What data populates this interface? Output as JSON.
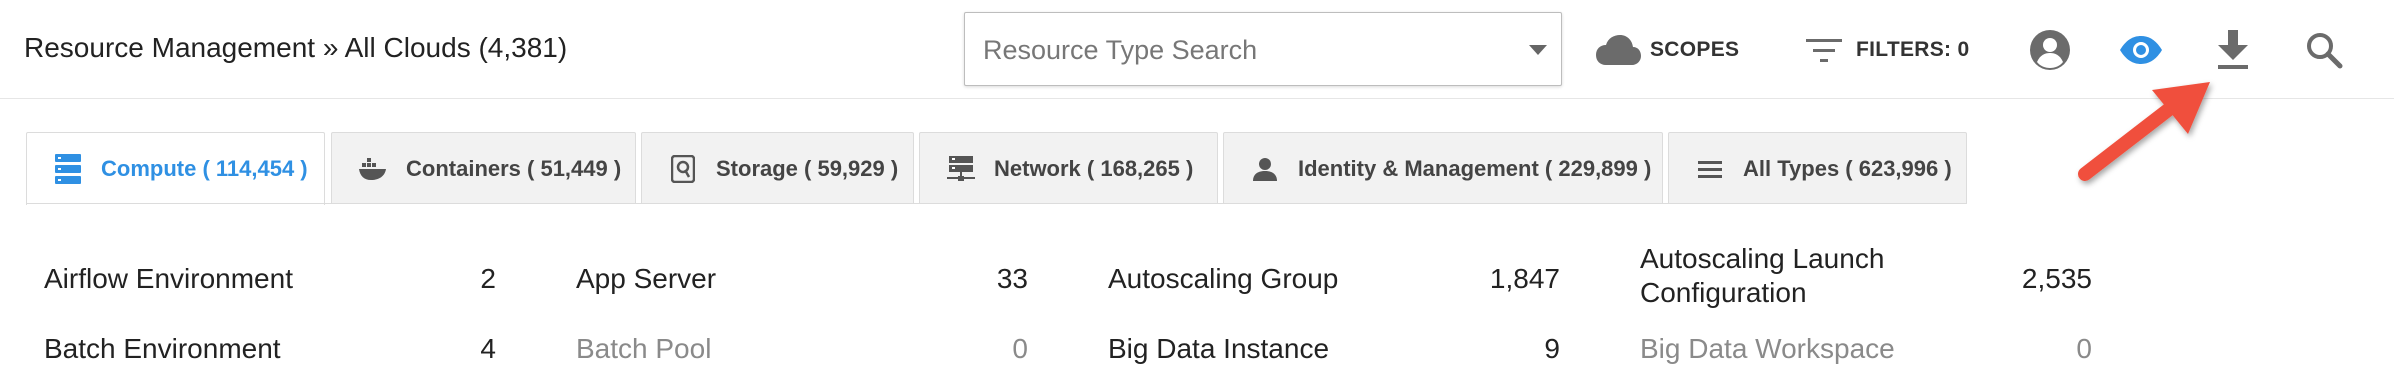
{
  "header": {
    "breadcrumb": "Resource Management » All Clouds (4,381)",
    "search": {
      "placeholder": "Resource Type Search",
      "value": ""
    },
    "scopes_label": "SCOPES",
    "filters_label": "FILTERS: 0",
    "icons": [
      "cloud-icon",
      "filter-icon",
      "account-circle-icon",
      "eye-icon",
      "download-icon",
      "search-icon"
    ],
    "accent_color": "#2f90e3"
  },
  "tabs": [
    {
      "label": "Compute ( 114,454 )",
      "icon": "server-icon",
      "active": true
    },
    {
      "label": "Containers ( 51,449 )",
      "icon": "docker-icon",
      "active": false
    },
    {
      "label": "Storage ( 59,929 )",
      "icon": "disk-icon",
      "active": false
    },
    {
      "label": "Network ( 168,265 )",
      "icon": "network-icon",
      "active": false
    },
    {
      "label": "Identity & Management ( 229,899 )",
      "icon": "person-icon",
      "active": false
    },
    {
      "label": "All Types ( 623,996 )",
      "icon": "list-icon",
      "active": false
    }
  ],
  "resources": [
    [
      {
        "name": "Airflow Environment",
        "count": "2"
      },
      {
        "name": "App Server",
        "count": "33"
      },
      {
        "name": "Autoscaling Group",
        "count": "1,847"
      },
      {
        "name": "Autoscaling Launch Configuration",
        "count": "2,535"
      }
    ],
    [
      {
        "name": "Batch Environment",
        "count": "4"
      },
      {
        "name": "Batch Pool",
        "count": "0"
      },
      {
        "name": "Big Data Instance",
        "count": "9"
      },
      {
        "name": "Big Data Workspace",
        "count": "0"
      }
    ]
  ],
  "annotation": {
    "arrow_color": "#f0503c"
  }
}
